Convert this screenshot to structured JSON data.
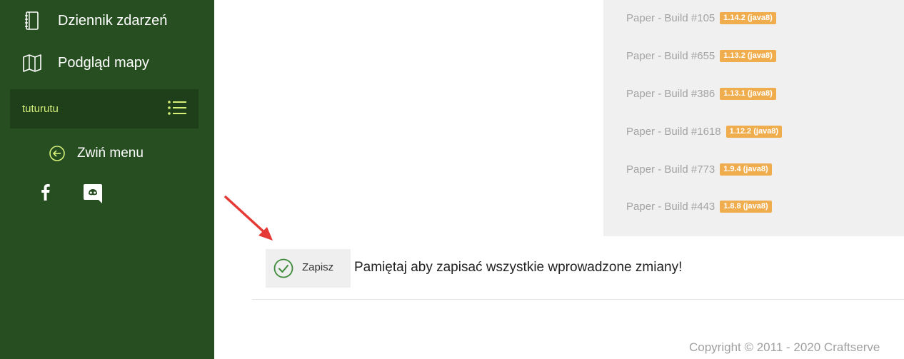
{
  "sidebar": {
    "items": [
      {
        "label": "Dziennik zdarzeń",
        "icon": "notebook-icon"
      },
      {
        "label": "Podgląd mapy",
        "icon": "map-icon"
      }
    ],
    "server": {
      "name": "tuturutu",
      "icon": "list-icon"
    },
    "collapse": {
      "label": "Zwiń menu",
      "icon": "arrow-left-circle-icon"
    },
    "social": [
      "facebook-icon",
      "discord-icon"
    ]
  },
  "builds": [
    {
      "name": "Paper - Build #105",
      "version": "1.14.2 (java8)"
    },
    {
      "name": "Paper - Build #655",
      "version": "1.13.2 (java8)"
    },
    {
      "name": "Paper - Build #386",
      "version": "1.13.1 (java8)"
    },
    {
      "name": "Paper - Build #1618",
      "version": "1.12.2 (java8)"
    },
    {
      "name": "Paper - Build #773",
      "version": "1.9.4 (java8)"
    },
    {
      "name": "Paper - Build #443",
      "version": "1.8.8 (java8)"
    }
  ],
  "save": {
    "label": "Zapisz",
    "message": "Pamiętaj aby zapisać wszystkie wprowadzone zmiany!"
  },
  "footer": {
    "copyright": "Copyright © 2011 - 2020 Craftserve"
  },
  "colors": {
    "sidebar": "#264e21",
    "server_box": "#1e3f19",
    "server_name": "#d6f07a",
    "badge": "#f0ad4e",
    "check": "#3c8a3a",
    "arrow": "#e53935"
  }
}
